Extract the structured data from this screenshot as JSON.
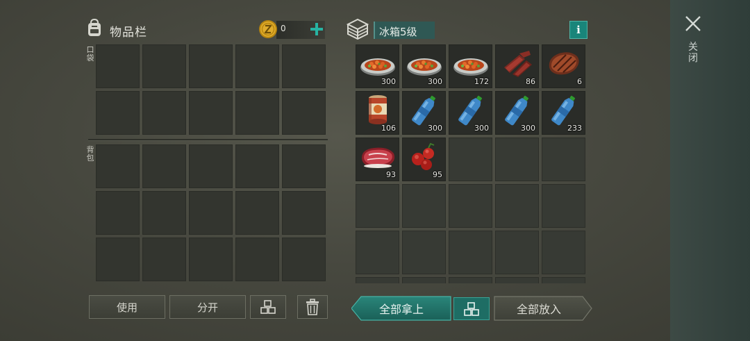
{
  "inventory": {
    "title": "物品栏",
    "coins": "0",
    "add_coin_symbol": "+",
    "pocket_label": "口袋",
    "backpack_label": "背包",
    "pocket_slots": 10,
    "backpack_slots": 15
  },
  "actions": {
    "use_label": "使用",
    "split_label": "分开"
  },
  "container": {
    "name": "冰箱5级",
    "info_symbol": "i",
    "items": [
      {
        "icon": "vegetable-stew-icon",
        "qty": "300"
      },
      {
        "icon": "vegetable-stew-icon",
        "qty": "300"
      },
      {
        "icon": "vegetable-stew-icon",
        "qty": "172"
      },
      {
        "icon": "jerky-icon",
        "qty": "86"
      },
      {
        "icon": "grilled-steak-icon",
        "qty": "6"
      },
      {
        "icon": "canned-food-icon",
        "qty": "106"
      },
      {
        "icon": "water-bottle-icon",
        "qty": "300"
      },
      {
        "icon": "water-bottle-icon",
        "qty": "300"
      },
      {
        "icon": "water-bottle-icon",
        "qty": "300"
      },
      {
        "icon": "water-bottle-icon",
        "qty": "233"
      },
      {
        "icon": "raw-meat-icon",
        "qty": "93"
      },
      {
        "icon": "berries-icon",
        "qty": "95"
      }
    ],
    "total_slots": 30,
    "take_all_label": "全部拿上",
    "put_all_label": "全部放入"
  },
  "close_label": "关闭",
  "colors": {
    "accent_teal": "#1e6d64",
    "info_teal": "#19857a",
    "coin_gold": "#d9a52a"
  }
}
